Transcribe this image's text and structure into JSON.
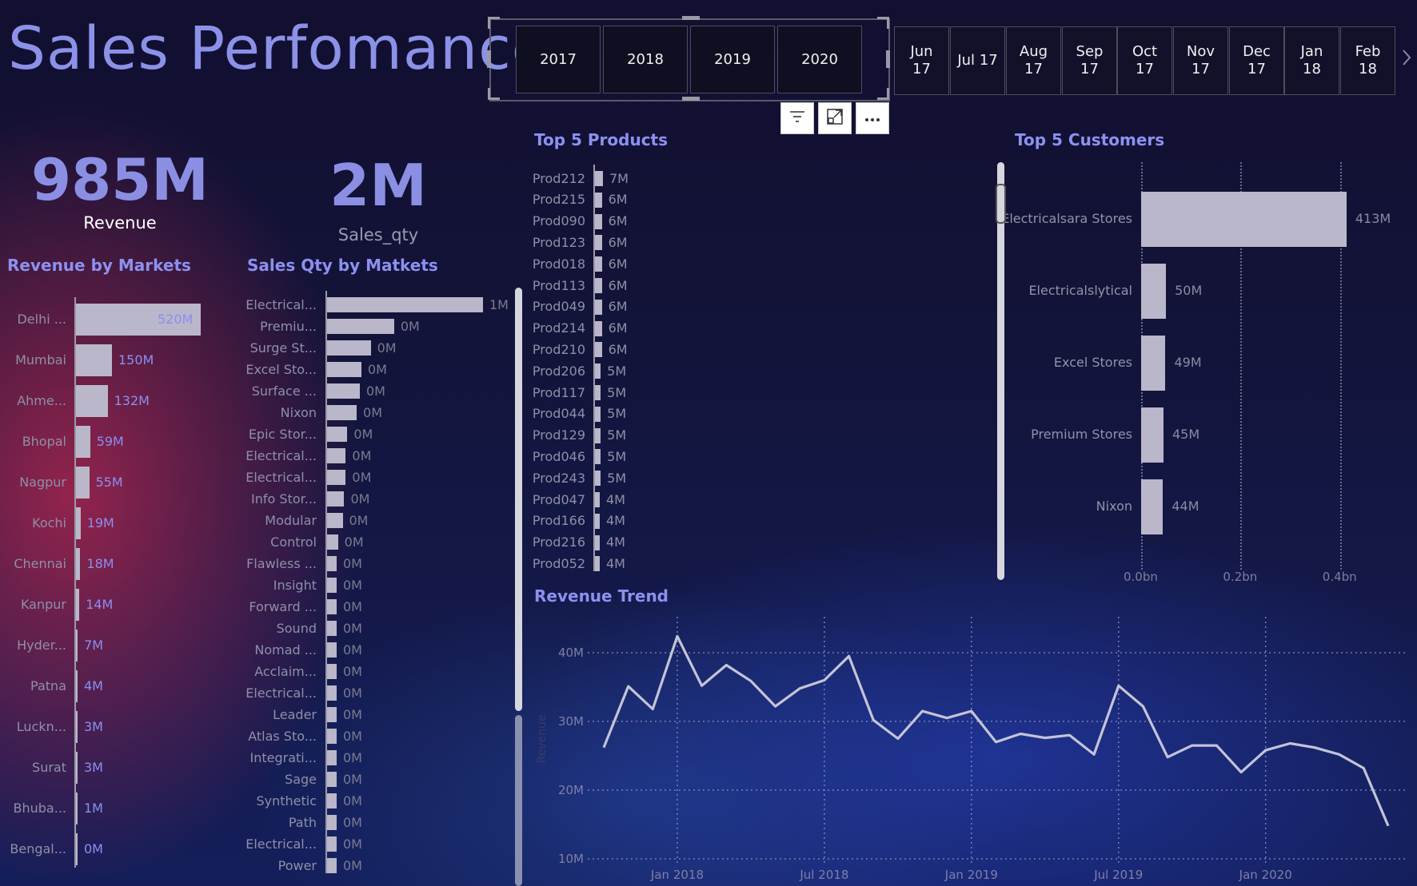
{
  "header": {
    "title": "Sales Perfomance"
  },
  "kpis": [
    {
      "value": "985M",
      "label": "Revenue"
    },
    {
      "value": "2M",
      "label": "Sales_qty"
    }
  ],
  "year_slicer": [
    "2017",
    "2018",
    "2019",
    "2020"
  ],
  "month_slicer": [
    [
      "Jun",
      "17"
    ],
    [
      "Jul 17",
      ""
    ],
    [
      "Aug",
      "17"
    ],
    [
      "Sep",
      "17"
    ],
    [
      "Oct",
      "17"
    ],
    [
      "Nov",
      "17"
    ],
    [
      "Dec",
      "17"
    ],
    [
      "Jan",
      "18"
    ],
    [
      "Feb",
      "18"
    ]
  ],
  "visual_toolbar": {
    "filter": "filter-icon",
    "focus": "focus-mode-icon",
    "more": "more-options-icon"
  },
  "revenue_by_markets": {
    "title": "Revenue by Markets",
    "rows": [
      {
        "label": "Delhi ...",
        "value": 520,
        "text": "520M"
      },
      {
        "label": "Mumbai",
        "value": 150,
        "text": "150M"
      },
      {
        "label": "Ahme...",
        "value": 132,
        "text": "132M"
      },
      {
        "label": "Bhopal",
        "value": 59,
        "text": "59M"
      },
      {
        "label": "Nagpur",
        "value": 55,
        "text": "55M"
      },
      {
        "label": "Kochi",
        "value": 19,
        "text": "19M"
      },
      {
        "label": "Chennai",
        "value": 18,
        "text": "18M"
      },
      {
        "label": "Kanpur",
        "value": 14,
        "text": "14M"
      },
      {
        "label": "Hyder...",
        "value": 7,
        "text": "7M"
      },
      {
        "label": "Patna",
        "value": 4,
        "text": "4M"
      },
      {
        "label": "Luckn...",
        "value": 3,
        "text": "3M"
      },
      {
        "label": "Surat",
        "value": 3,
        "text": "3M"
      },
      {
        "label": "Bhuba...",
        "value": 1,
        "text": "1M"
      },
      {
        "label": "Bengal...",
        "value": 0,
        "text": "0M"
      }
    ]
  },
  "sales_qty_by_markets": {
    "title": "Sales Qty by Matkets",
    "rows": [
      {
        "label": "Electrical...",
        "value": 1.0,
        "text": "1M"
      },
      {
        "label": "Premiu...",
        "value": 0.43,
        "text": "0M"
      },
      {
        "label": "Surge St...",
        "value": 0.28,
        "text": "0M"
      },
      {
        "label": "Excel Sto...",
        "value": 0.22,
        "text": "0M"
      },
      {
        "label": "Surface ...",
        "value": 0.21,
        "text": "0M"
      },
      {
        "label": "Nixon",
        "value": 0.19,
        "text": "0M"
      },
      {
        "label": "Epic Stor...",
        "value": 0.13,
        "text": "0M"
      },
      {
        "label": "Electrical...",
        "value": 0.12,
        "text": "0M"
      },
      {
        "label": "Electrical...",
        "value": 0.12,
        "text": "0M"
      },
      {
        "label": "Info Stor...",
        "value": 0.11,
        "text": "0M"
      },
      {
        "label": "Modular",
        "value": 0.1,
        "text": "0M"
      },
      {
        "label": "Control",
        "value": 0.07,
        "text": "0M"
      },
      {
        "label": "Flawless ...",
        "value": 0.06,
        "text": "0M"
      },
      {
        "label": "Insight",
        "value": 0.05,
        "text": "0M"
      },
      {
        "label": "Forward ...",
        "value": 0.05,
        "text": "0M"
      },
      {
        "label": "Sound",
        "value": 0.05,
        "text": "0M"
      },
      {
        "label": "Nomad ...",
        "value": 0.05,
        "text": "0M"
      },
      {
        "label": "Acclaim...",
        "value": 0.04,
        "text": "0M"
      },
      {
        "label": "Electrical...",
        "value": 0.04,
        "text": "0M"
      },
      {
        "label": "Leader",
        "value": 0.04,
        "text": "0M"
      },
      {
        "label": "Atlas Sto...",
        "value": 0.04,
        "text": "0M"
      },
      {
        "label": "Integrati...",
        "value": 0.04,
        "text": "0M"
      },
      {
        "label": "Sage",
        "value": 0.04,
        "text": "0M"
      },
      {
        "label": "Synthetic",
        "value": 0.03,
        "text": "0M"
      },
      {
        "label": "Path",
        "value": 0.03,
        "text": "0M"
      },
      {
        "label": "Electrical...",
        "value": 0.03,
        "text": "0M"
      },
      {
        "label": "Power",
        "value": 0.03,
        "text": "0M"
      }
    ]
  },
  "top_products": {
    "title": "Top 5 Products",
    "rows": [
      {
        "label": "Prod212",
        "value": 7,
        "text": "7M"
      },
      {
        "label": "Prod215",
        "value": 6,
        "text": "6M"
      },
      {
        "label": "Prod090",
        "value": 6,
        "text": "6M"
      },
      {
        "label": "Prod123",
        "value": 6,
        "text": "6M"
      },
      {
        "label": "Prod018",
        "value": 6,
        "text": "6M"
      },
      {
        "label": "Prod113",
        "value": 6,
        "text": "6M"
      },
      {
        "label": "Prod049",
        "value": 6,
        "text": "6M"
      },
      {
        "label": "Prod214",
        "value": 6,
        "text": "6M"
      },
      {
        "label": "Prod210",
        "value": 6,
        "text": "6M"
      },
      {
        "label": "Prod206",
        "value": 5,
        "text": "5M"
      },
      {
        "label": "Prod117",
        "value": 5,
        "text": "5M"
      },
      {
        "label": "Prod044",
        "value": 5,
        "text": "5M"
      },
      {
        "label": "Prod129",
        "value": 5,
        "text": "5M"
      },
      {
        "label": "Prod046",
        "value": 5,
        "text": "5M"
      },
      {
        "label": "Prod243",
        "value": 5,
        "text": "5M"
      },
      {
        "label": "Prod047",
        "value": 4,
        "text": "4M"
      },
      {
        "label": "Prod166",
        "value": 4,
        "text": "4M"
      },
      {
        "label": "Prod216",
        "value": 4,
        "text": "4M"
      },
      {
        "label": "Prod052",
        "value": 4,
        "text": "4M"
      }
    ]
  },
  "top_customers": {
    "title": "Top 5 Customers",
    "rows": [
      {
        "label": "Electricalsara Stores",
        "value": 0.413,
        "text": "413M"
      },
      {
        "label": "Electricalslytical",
        "value": 0.05,
        "text": "50M"
      },
      {
        "label": "Excel Stores",
        "value": 0.049,
        "text": "49M"
      },
      {
        "label": "Premium Stores",
        "value": 0.045,
        "text": "45M"
      },
      {
        "label": "Nixon",
        "value": 0.044,
        "text": "44M"
      }
    ],
    "ticks": [
      "0.0bn",
      "0.2bn",
      "0.4bn"
    ]
  },
  "chart_data": {
    "type": "line",
    "title": "Revenue Trend",
    "ylabel": "Revenue",
    "ylim": [
      10,
      43
    ],
    "y_ticks": [
      "40M",
      "30M",
      "20M",
      "10M"
    ],
    "x_ticks": [
      "Jan 2018",
      "Jul 2018",
      "Jan 2019",
      "Jul 2019",
      "Jan 2020"
    ],
    "series": [
      {
        "values": [
          26.2,
          35.1,
          31.8,
          42.4,
          35.2,
          38.2,
          35.9,
          32.2,
          34.8,
          36.0,
          39.5,
          30.2,
          27.5,
          31.5,
          30.5,
          31.5,
          27.0,
          28.2,
          27.6,
          28.0,
          25.2,
          35.2,
          32.2,
          24.8,
          26.5,
          26.5,
          22.6,
          25.8,
          26.8,
          26.2,
          25.2,
          23.2,
          14.8
        ]
      }
    ]
  }
}
